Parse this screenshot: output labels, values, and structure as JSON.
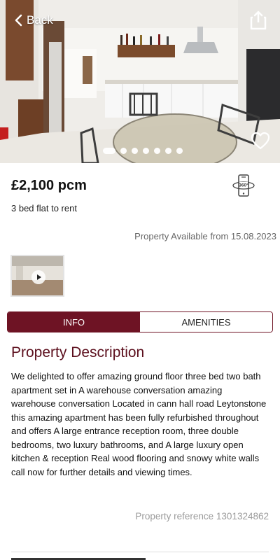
{
  "header": {
    "back_label": "Back",
    "icons": [
      "chevron-left-icon",
      "share-icon",
      "heart-icon"
    ]
  },
  "gallery": {
    "image_count": 7,
    "active_index": 0,
    "overlay_color": "#ffffff"
  },
  "listing": {
    "price": "£2,100 pcm",
    "subtitle": "3 bed flat to rent",
    "availability": "Property Available from 15.08.2023",
    "view360_icon": "phone-360-icon"
  },
  "video": {
    "play_icon": "play-icon"
  },
  "tabs": [
    {
      "label": "INFO",
      "active": true
    },
    {
      "label": "AMENITIES",
      "active": false
    }
  ],
  "description": {
    "title": "Property Description",
    "body": "We delighted to offer amazing ground floor three bed two bath apartment set in A warehouse conversation amazing warehouse conversation Located in cann hall road Leytonstone this amazing apartment has been fully refurbished throughout and offers A large entrance reception room, three double bedrooms, two luxury bathrooms, and A large luxury open kitchen & reception Real wood flooring and snowy white walls call now for further details and viewing times.",
    "reference": "Property reference 1301324862"
  },
  "colors": {
    "brand": "#6e1324",
    "title": "#5c0f1d",
    "muted": "#9b9b9b"
  }
}
